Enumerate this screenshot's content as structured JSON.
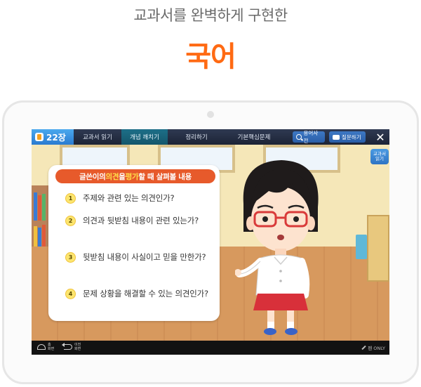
{
  "header": {
    "subtitle": "교과서를 완벽하게 구현한",
    "title": "국어"
  },
  "toolbar": {
    "chapter": "22장",
    "tabs": [
      {
        "label": "교과서 읽기",
        "active": false
      },
      {
        "label": "개념 깨치기",
        "active": true
      },
      {
        "label": "정리하기",
        "active": false
      },
      {
        "label": "기본핵심문제",
        "active": false
      }
    ],
    "dictionary_label": "용어사전",
    "question_label": "질문하기",
    "close_label": "✕"
  },
  "side": {
    "read_textbook": "교과서 읽기"
  },
  "card": {
    "banner_pre": "글쓴이의 ",
    "banner_hl1": "의견",
    "banner_mid": "을 ",
    "banner_hl2": "평가",
    "banner_post": "할 때 살펴볼 내용",
    "items": [
      {
        "num": "1",
        "text": "주제와 관련 있는 의견인가?"
      },
      {
        "num": "2",
        "text": "의견과 뒷받침 내용이 관련 있는가?"
      },
      {
        "num": "3",
        "text": "뒷받침 내용이 사실이고 믿을 만한가?"
      },
      {
        "num": "4",
        "text": "문제 상황을 해결할 수 있는 의견인가?"
      }
    ]
  },
  "bottombar": {
    "home_label": "홈 화면",
    "back_label": "이전 화면",
    "pen_only": "펜 ONLY"
  },
  "colors": {
    "accent_orange": "#ff6a13",
    "banner": "#e75a2b",
    "highlight_yellow": "#ffe04a"
  }
}
